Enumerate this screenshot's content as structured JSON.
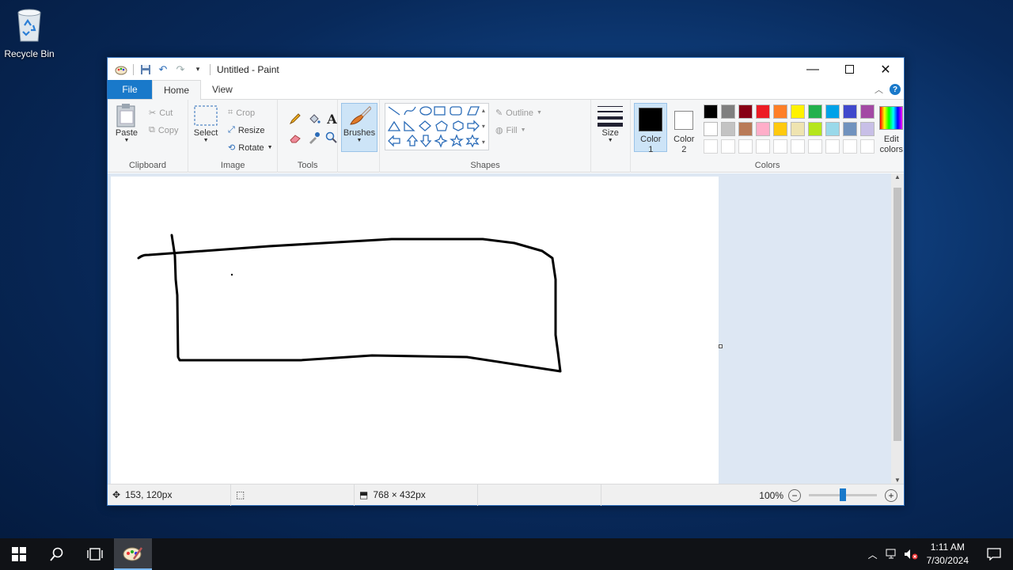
{
  "desktop": {
    "recycle_bin_label": "Recycle Bin"
  },
  "window": {
    "title": "Untitled - Paint"
  },
  "tabs": {
    "file": "File",
    "home": "Home",
    "view": "View"
  },
  "ribbon": {
    "clipboard": {
      "paste": "Paste",
      "cut": "Cut",
      "copy": "Copy",
      "label": "Clipboard"
    },
    "image": {
      "select": "Select",
      "crop": "Crop",
      "resize": "Resize",
      "rotate": "Rotate",
      "label": "Image"
    },
    "tools": {
      "label": "Tools"
    },
    "brushes": {
      "label": "Brushes"
    },
    "shapes": {
      "outline": "Outline",
      "fill": "Fill",
      "label": "Shapes"
    },
    "size": {
      "label": "Size"
    },
    "colors": {
      "color1": "Color 1",
      "color2": "Color 2",
      "edit": "Edit colors",
      "label": "Colors",
      "color1_value": "#000000",
      "color2_value": "#ffffff",
      "row1": [
        "#000000",
        "#7f7f7f",
        "#880015",
        "#ed1c24",
        "#ff7f27",
        "#fff200",
        "#22b14c",
        "#00a2e8",
        "#3f48cc",
        "#a349a4"
      ],
      "row2": [
        "#ffffff",
        "#c3c3c3",
        "#b97a57",
        "#ffaec9",
        "#ffc90e",
        "#efe4b0",
        "#b5e61d",
        "#99d9ea",
        "#7092be",
        "#c8bfe7"
      ]
    }
  },
  "status": {
    "cursor": "153, 120px",
    "canvas_size": "768 × 432px",
    "zoom": "100%",
    "zoom_level": 0.5
  },
  "taskbar": {
    "time": "1:11 AM",
    "date": "7/30/2024"
  }
}
